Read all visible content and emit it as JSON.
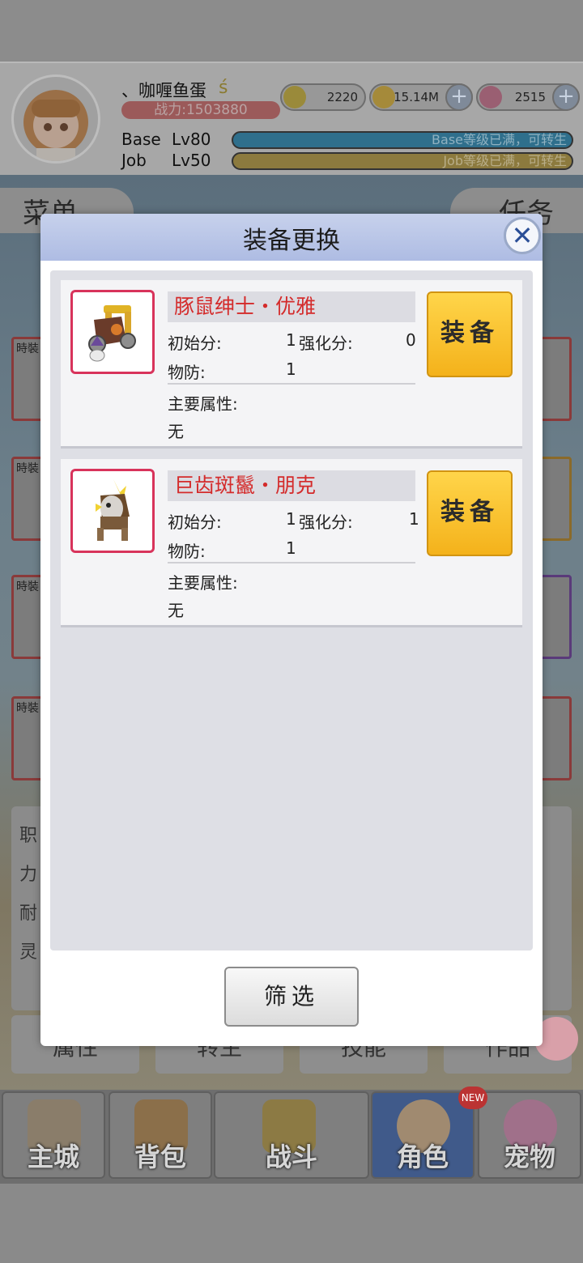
{
  "header": {
    "player_name": "、咖喱鱼蛋",
    "power": "战力:1503880",
    "resources": [
      {
        "icon": "zeny-coin-icon",
        "value": "2220"
      },
      {
        "icon": "gold-coin-icon",
        "value": "15.14M"
      },
      {
        "icon": "crystal-icon",
        "value": "2515"
      }
    ],
    "base_label": "Base",
    "base_level": "Lv80",
    "base_status": "Base等级已满，可转生",
    "job_label": "Job",
    "job_level": "Lv50",
    "job_status": "Job等级已满，可转生",
    "accent_blue": "#2f8fb7",
    "accent_gold": "#b89b3c"
  },
  "background": {
    "menu_tab": "菜单",
    "quest_tab": "任务",
    "slot_label": "時裝",
    "stat_chars": [
      "职",
      "力",
      "耐",
      "灵"
    ],
    "dim_tabs": [
      "属性",
      "转生",
      "技能",
      "作品"
    ]
  },
  "dialog": {
    "title": "装备更换",
    "close_icon": "close-icon",
    "items": [
      {
        "name": "豚鼠绅士・优雅",
        "initial_label": "初始分:",
        "initial_value": "1",
        "enhance_label": "强化分:",
        "enhance_value": "0",
        "defense_label": "物防:",
        "defense_value": "1",
        "attr_label": "主要属性:",
        "attr_value": "无",
        "button": "装备",
        "icon": "cart-mount-icon"
      },
      {
        "name": "巨齿斑鬣・朋克",
        "initial_label": "初始分:",
        "initial_value": "1",
        "enhance_label": "强化分:",
        "enhance_value": "1",
        "defense_label": "物防:",
        "defense_value": "1",
        "attr_label": "主要属性:",
        "attr_value": "无",
        "button": "装备",
        "icon": "hyena-mount-icon"
      }
    ],
    "filter_button": "筛选",
    "name_color": "#d42b2b",
    "button_color": "#f4b21b"
  },
  "navbar": {
    "items": [
      {
        "label": "主城",
        "icon": "castle-icon"
      },
      {
        "label": "背包",
        "icon": "backpack-icon"
      },
      {
        "label": "战斗",
        "icon": "crossed-swords-icon"
      },
      {
        "label": "角色",
        "icon": "character-icon",
        "active": true
      },
      {
        "label": "宠物",
        "icon": "poring-pet-icon"
      }
    ],
    "new_badge": "NEW"
  }
}
